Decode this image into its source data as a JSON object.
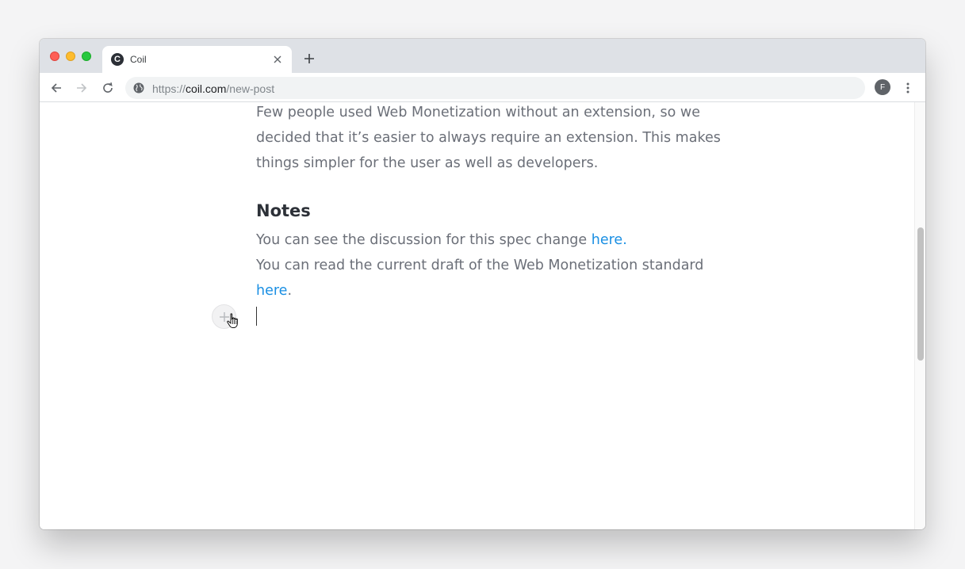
{
  "browser": {
    "tab": {
      "favicon_letter": "C",
      "title": "Coil"
    },
    "address": {
      "scheme": "https://",
      "host": "coil.com",
      "path": "/new-post"
    },
    "profile_initial": "F"
  },
  "article": {
    "paragraph_1": "Few people used Web Monetization without an extension, so we decided that it’s easier to always require an extension. This makes things simpler for the user as well as developers.",
    "heading": "Notes",
    "line_1_text": "You can see the discussion for this spec change ",
    "line_1_link": "here",
    "line_1_end": ".",
    "line_2_text": "You can read the current draft of the Web Monetization standard ",
    "line_2_link": "here",
    "line_2_end": "."
  },
  "colors": {
    "link": "#1a8fe3",
    "body_text": "#6b6f78",
    "heading": "#2d3138"
  },
  "icons": [
    "back-icon",
    "forward-icon",
    "reload-icon",
    "globe-icon",
    "close-icon",
    "plus-icon",
    "kebab-menu-icon",
    "hand-pointer-icon"
  ]
}
